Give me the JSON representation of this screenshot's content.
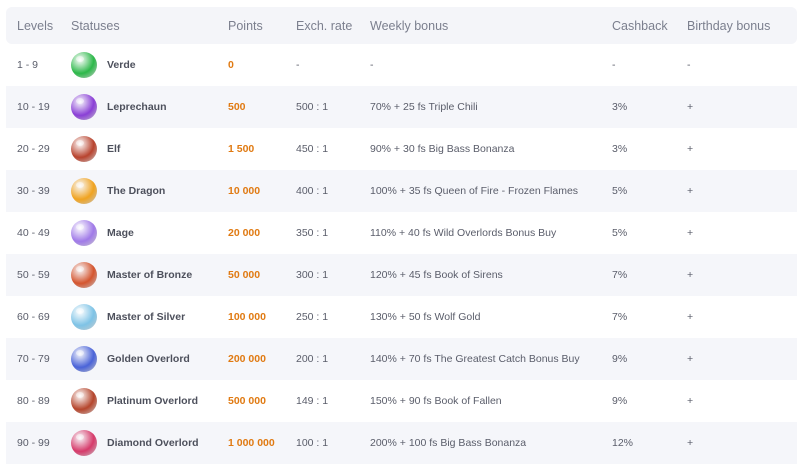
{
  "headers": {
    "levels": "Levels",
    "statuses": "Statuses",
    "points": "Points",
    "rate": "Exch. rate",
    "bonus": "Weekly bonus",
    "cashback": "Cashback",
    "birthday": "Birthday bonus"
  },
  "rows": [
    {
      "level": "1 - 9",
      "status": "Verde",
      "icon": "green-spiky-planet-icon",
      "color": "#2db84a",
      "points": "0",
      "rate": "-",
      "bonus": "-",
      "cashback": "-",
      "birthday": "-"
    },
    {
      "level": "10 - 19",
      "status": "Leprechaun",
      "icon": "purple-planet-icon",
      "color": "#8a3fd6",
      "points": "500",
      "rate": "500 : 1",
      "bonus": "70% + 25 fs Triple Chili",
      "cashback": "3%",
      "birthday": "+"
    },
    {
      "level": "20 - 29",
      "status": "Elf",
      "icon": "red-rocky-planet-icon",
      "color": "#b8432e",
      "points": "1 500",
      "rate": "450 : 1",
      "bonus": "90% + 30 fs Big Bass Bonanza",
      "cashback": "3%",
      "birthday": "+"
    },
    {
      "level": "30 - 39",
      "status": "The Dragon",
      "icon": "orange-planet-icon",
      "color": "#f0a320",
      "points": "10 000",
      "rate": "400 : 1",
      "bonus": "100% + 35 fs Queen of Fire - Frozen Flames",
      "cashback": "5%",
      "birthday": "+"
    },
    {
      "level": "40 - 49",
      "status": "Mage",
      "icon": "violet-blob-planet-icon",
      "color": "#a07ae8",
      "points": "20 000",
      "rate": "350 : 1",
      "bonus": "110% + 40 fs Wild Overlords Bonus Buy",
      "cashback": "5%",
      "birthday": "+"
    },
    {
      "level": "50 - 59",
      "status": "Master of Bronze",
      "icon": "bronze-striped-planet-icon",
      "color": "#d4552f",
      "points": "50 000",
      "rate": "300 : 1",
      "bonus": "120% + 45 fs Book of Sirens",
      "cashback": "7%",
      "birthday": "+"
    },
    {
      "level": "60 - 69",
      "status": "Master of Silver",
      "icon": "silver-blue-planet-icon",
      "color": "#7ec3e6",
      "points": "100 000",
      "rate": "250 : 1",
      "bonus": "130% + 50 fs Wolf Gold",
      "cashback": "7%",
      "birthday": "+"
    },
    {
      "level": "70 - 79",
      "status": "Golden Overlord",
      "icon": "blue-planet-icon",
      "color": "#4a63d8",
      "points": "200 000",
      "rate": "200 : 1",
      "bonus": "140% + 70 fs The Greatest Catch Bonus Buy",
      "cashback": "9%",
      "birthday": "+"
    },
    {
      "level": "80 - 89",
      "status": "Platinum Overlord",
      "icon": "red-brown-planet-icon",
      "color": "#b5452c",
      "points": "500 000",
      "rate": "149 : 1",
      "bonus": "150% + 90 fs Book of Fallen",
      "cashback": "9%",
      "birthday": "+"
    },
    {
      "level": "90 - 99",
      "status": "Diamond Overlord",
      "icon": "crystal-planet-icon",
      "color": "#d63a6a",
      "points": "1 000 000",
      "rate": "100 : 1",
      "bonus": "200% + 100 fs Big Bass Bonanza",
      "cashback": "12%",
      "birthday": "+"
    }
  ]
}
